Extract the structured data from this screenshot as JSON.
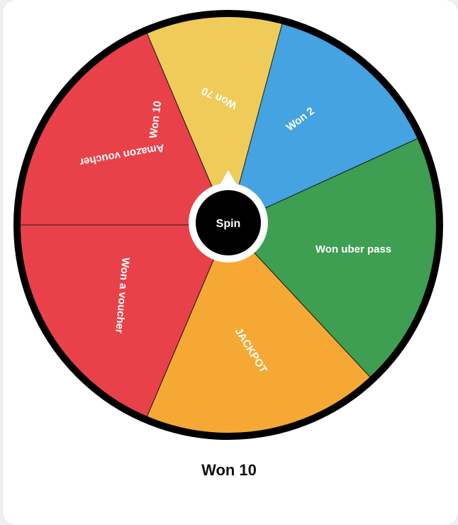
{
  "wheel": {
    "rim_color": "#000000",
    "segments": [
      {
        "label": "Won 10",
        "color": "#8460CF",
        "start_deg": -162.5,
        "end_deg": -86.5
      },
      {
        "label": "Won 2",
        "color": "#44A3E0",
        "start_deg": -86.5,
        "end_deg": -24.5
      },
      {
        "label": "Won uber pass",
        "color": "#3E9E52",
        "start_deg": -24.5,
        "end_deg": 47.0
      },
      {
        "label": "JACKPOT",
        "color": "#F6A834",
        "start_deg": 47.0,
        "end_deg": 113.0
      },
      {
        "label": "Won a voucher",
        "color": "#E8414A",
        "start_deg": 113.0,
        "end_deg": 180.0
      },
      {
        "label": "Amazon voucher",
        "color": "#E8414A",
        "start_deg": 180.0,
        "end_deg": 247.0
      },
      {
        "label": "Won 70",
        "color": "#EFCB5A",
        "start_deg": 247.0,
        "end_deg": 285.0
      }
    ],
    "label_rotations": {
      "Won 10": -83,
      "Won 2": -37,
      "Won uber pass": 0,
      "JACKPOT": 58,
      "Won a voucher": 95,
      "Amazon voucher": 170,
      "Won 70": 205
    }
  },
  "spin_button": {
    "label": "Spin",
    "color": "#000000"
  },
  "result": {
    "text": "Won 10"
  }
}
